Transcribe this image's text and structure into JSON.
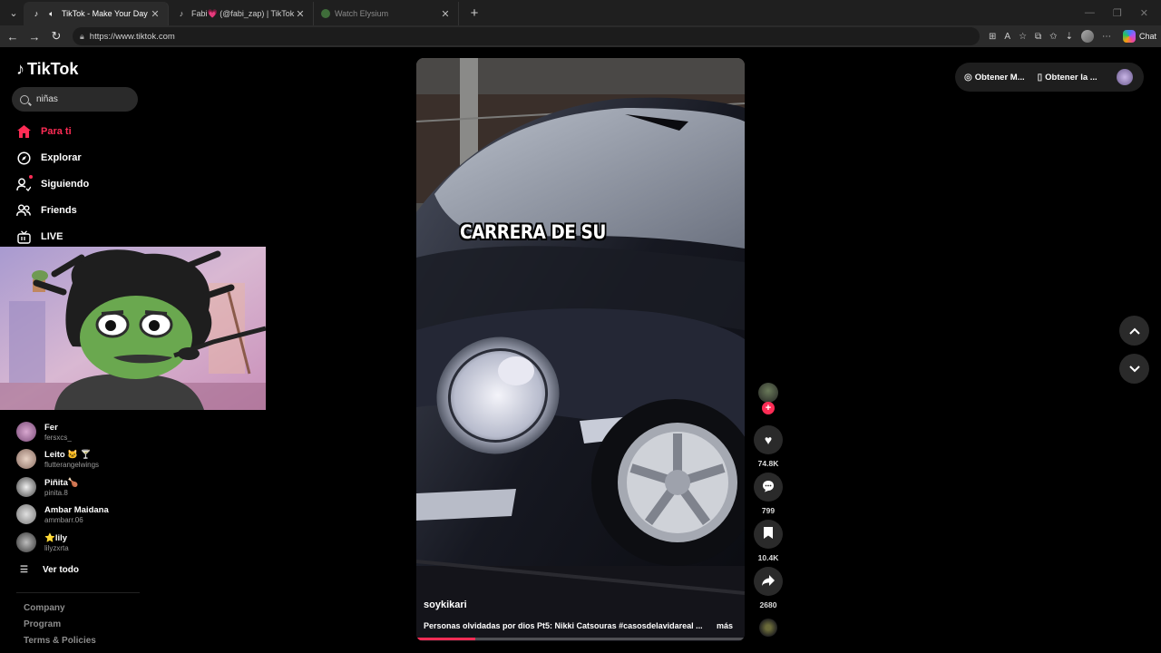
{
  "browser": {
    "tabs": [
      {
        "title": "TikTok - Make Your Day",
        "active": true
      },
      {
        "title": "Fabi💗 (@fabi_zap) | TikTok",
        "active": false
      },
      {
        "title": "Watch Elysium",
        "active": false
      }
    ],
    "url": "https://www.tiktok.com",
    "chat_label": "Chat"
  },
  "sidebar": {
    "logo": "TikTok",
    "search_value": "niñas",
    "nav": [
      {
        "label": "Para ti",
        "icon": "home-icon",
        "active": true
      },
      {
        "label": "Explorar",
        "icon": "compass-icon",
        "active": false
      },
      {
        "label": "Siguiendo",
        "icon": "following-icon",
        "active": false
      },
      {
        "label": "Friends",
        "icon": "friends-icon",
        "active": false
      },
      {
        "label": "LIVE",
        "icon": "live-icon",
        "active": false
      }
    ],
    "accounts": [
      {
        "name": "Fer",
        "handle": "fersxcs_"
      },
      {
        "name": "Leito 🐱 🍸",
        "handle": "flutterangelwings"
      },
      {
        "name": "Piñita🍗",
        "handle": "pinita.8"
      },
      {
        "name": "Ambar Maidana",
        "handle": "ammbarr.06"
      },
      {
        "name": "⭐lily",
        "handle": "lilyzxrta"
      }
    ],
    "see_all": "Ver todo",
    "footer": [
      "Company",
      "Program",
      "Terms & Policies"
    ]
  },
  "video": {
    "overlay_text": "CARRERA DE SU",
    "author": "soykikari",
    "description": "Personas olvidadas por dios Pt5: Nikki Catsouras #casosdelavidareal ...",
    "more_label": "más",
    "progress": 0.18,
    "likes": "74.8K",
    "comments": "799",
    "saves": "10.4K",
    "shares": "2680"
  },
  "topright": {
    "item1": "Obtener M...",
    "item2": "Obtener la ..."
  }
}
